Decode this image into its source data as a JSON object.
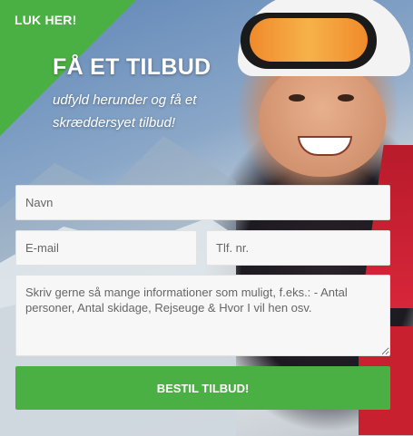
{
  "ribbon": {
    "label": "LUK HER!"
  },
  "header": {
    "title": "FÅ ET TILBUD",
    "subtitle": "udfyld herunder og få et skræddersyet tilbud!"
  },
  "form": {
    "name_placeholder": "Navn",
    "email_placeholder": "E-mail",
    "phone_placeholder": "Tlf. nr.",
    "message_placeholder": "Skriv gerne så mange informationer som muligt, f.eks.: - Antal personer, Antal skidage, Rejseuge & Hvor I vil hen osv.",
    "submit_label": "BESTIL TILBUD!"
  },
  "colors": {
    "accent": "#4bb043",
    "field_bg": "#f7f7f7",
    "text_light": "#ffffff"
  }
}
